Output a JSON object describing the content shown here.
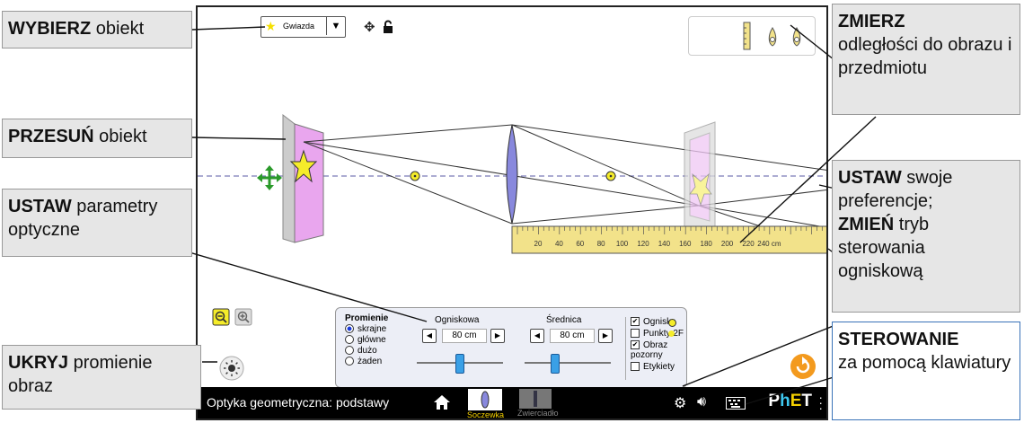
{
  "sim": {
    "title": "Optyka geometryczna: podstawy",
    "object_selector": {
      "selected": "Gwiazda"
    },
    "screens": [
      {
        "label": "Soczewka",
        "selected": true
      },
      {
        "label": "Zwierciadło",
        "selected": false
      }
    ],
    "ruler_ticks": [
      "20",
      "40",
      "60",
      "80",
      "100",
      "120",
      "140",
      "160",
      "180",
      "200",
      "220",
      "240 cm"
    ],
    "controls": {
      "rays": {
        "title": "Promienie",
        "options": [
          "skrajne",
          "główne",
          "dużo",
          "żaden"
        ],
        "selected": "skrajne"
      },
      "focal": {
        "label": "Ogniskowa",
        "value": "80 cm",
        "fraction": 0.5
      },
      "diameter": {
        "label": "Średnica",
        "value": "80 cm",
        "fraction": 0.35
      },
      "checkboxes": [
        {
          "label": "Ogniska",
          "checked": true
        },
        {
          "label": "Punkty 2F",
          "checked": false
        },
        {
          "label": "Obraz pozorny",
          "checked": true
        },
        {
          "label": "Etykiety",
          "checked": false
        }
      ]
    },
    "brand": {
      "p": "P",
      "h": "h",
      "e": "E",
      "t": "T"
    },
    "colors": {
      "accent": "#f5d000",
      "navbar": "#000000",
      "object": "#e9a6ee",
      "lens": "#8888dd",
      "ruler": "#f2e28a",
      "reset": "#f39a1e"
    }
  },
  "callouts": {
    "select": {
      "bold": "WYBIERZ",
      "rest": " obiekt"
    },
    "move": {
      "bold": "PRZESUŃ",
      "rest": " obiekt"
    },
    "optics": {
      "bold": "USTAW",
      "rest": " parametry optyczne"
    },
    "hide": {
      "bold": "UKRYJ",
      "rest": " promienie obraz"
    },
    "measure": {
      "bold": "ZMIERZ",
      "rest": "odległości do obrazu i przedmiotu"
    },
    "prefs": {
      "bold1": "USTAW",
      "rest1": " swoje preferencje;",
      "bold2": "ZMIEŃ",
      "rest2": " tryb sterowania ogniskową"
    },
    "keyboard": {
      "bold": "STEROWANIE",
      "rest": "za pomocą klawiatury"
    }
  }
}
